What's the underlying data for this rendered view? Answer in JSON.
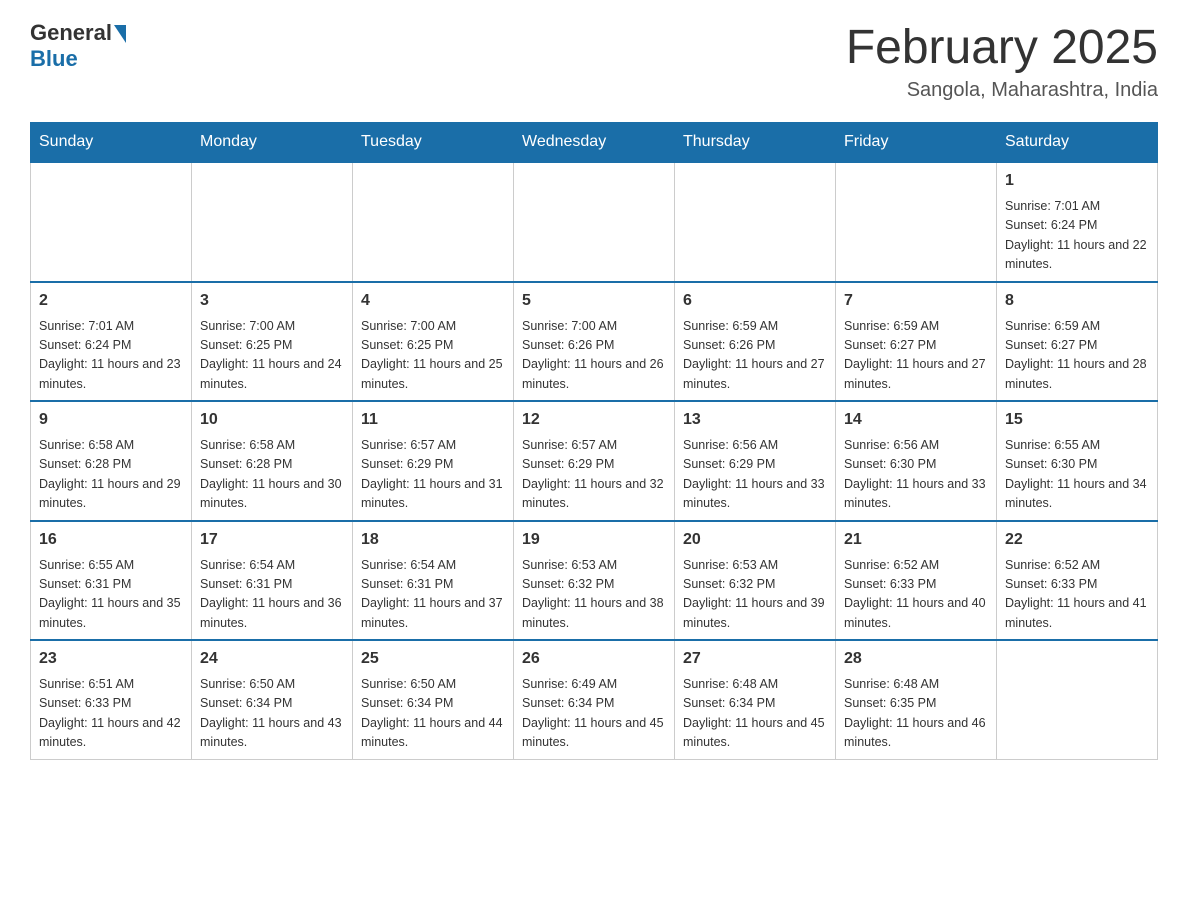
{
  "logo": {
    "general": "General",
    "blue": "Blue"
  },
  "title": "February 2025",
  "location": "Sangola, Maharashtra, India",
  "days_of_week": [
    "Sunday",
    "Monday",
    "Tuesday",
    "Wednesday",
    "Thursday",
    "Friday",
    "Saturday"
  ],
  "weeks": [
    [
      {
        "day": "",
        "sunrise": "",
        "sunset": "",
        "daylight": ""
      },
      {
        "day": "",
        "sunrise": "",
        "sunset": "",
        "daylight": ""
      },
      {
        "day": "",
        "sunrise": "",
        "sunset": "",
        "daylight": ""
      },
      {
        "day": "",
        "sunrise": "",
        "sunset": "",
        "daylight": ""
      },
      {
        "day": "",
        "sunrise": "",
        "sunset": "",
        "daylight": ""
      },
      {
        "day": "",
        "sunrise": "",
        "sunset": "",
        "daylight": ""
      },
      {
        "day": "1",
        "sunrise": "Sunrise: 7:01 AM",
        "sunset": "Sunset: 6:24 PM",
        "daylight": "Daylight: 11 hours and 22 minutes."
      }
    ],
    [
      {
        "day": "2",
        "sunrise": "Sunrise: 7:01 AM",
        "sunset": "Sunset: 6:24 PM",
        "daylight": "Daylight: 11 hours and 23 minutes."
      },
      {
        "day": "3",
        "sunrise": "Sunrise: 7:00 AM",
        "sunset": "Sunset: 6:25 PM",
        "daylight": "Daylight: 11 hours and 24 minutes."
      },
      {
        "day": "4",
        "sunrise": "Sunrise: 7:00 AM",
        "sunset": "Sunset: 6:25 PM",
        "daylight": "Daylight: 11 hours and 25 minutes."
      },
      {
        "day": "5",
        "sunrise": "Sunrise: 7:00 AM",
        "sunset": "Sunset: 6:26 PM",
        "daylight": "Daylight: 11 hours and 26 minutes."
      },
      {
        "day": "6",
        "sunrise": "Sunrise: 6:59 AM",
        "sunset": "Sunset: 6:26 PM",
        "daylight": "Daylight: 11 hours and 27 minutes."
      },
      {
        "day": "7",
        "sunrise": "Sunrise: 6:59 AM",
        "sunset": "Sunset: 6:27 PM",
        "daylight": "Daylight: 11 hours and 27 minutes."
      },
      {
        "day": "8",
        "sunrise": "Sunrise: 6:59 AM",
        "sunset": "Sunset: 6:27 PM",
        "daylight": "Daylight: 11 hours and 28 minutes."
      }
    ],
    [
      {
        "day": "9",
        "sunrise": "Sunrise: 6:58 AM",
        "sunset": "Sunset: 6:28 PM",
        "daylight": "Daylight: 11 hours and 29 minutes."
      },
      {
        "day": "10",
        "sunrise": "Sunrise: 6:58 AM",
        "sunset": "Sunset: 6:28 PM",
        "daylight": "Daylight: 11 hours and 30 minutes."
      },
      {
        "day": "11",
        "sunrise": "Sunrise: 6:57 AM",
        "sunset": "Sunset: 6:29 PM",
        "daylight": "Daylight: 11 hours and 31 minutes."
      },
      {
        "day": "12",
        "sunrise": "Sunrise: 6:57 AM",
        "sunset": "Sunset: 6:29 PM",
        "daylight": "Daylight: 11 hours and 32 minutes."
      },
      {
        "day": "13",
        "sunrise": "Sunrise: 6:56 AM",
        "sunset": "Sunset: 6:29 PM",
        "daylight": "Daylight: 11 hours and 33 minutes."
      },
      {
        "day": "14",
        "sunrise": "Sunrise: 6:56 AM",
        "sunset": "Sunset: 6:30 PM",
        "daylight": "Daylight: 11 hours and 33 minutes."
      },
      {
        "day": "15",
        "sunrise": "Sunrise: 6:55 AM",
        "sunset": "Sunset: 6:30 PM",
        "daylight": "Daylight: 11 hours and 34 minutes."
      }
    ],
    [
      {
        "day": "16",
        "sunrise": "Sunrise: 6:55 AM",
        "sunset": "Sunset: 6:31 PM",
        "daylight": "Daylight: 11 hours and 35 minutes."
      },
      {
        "day": "17",
        "sunrise": "Sunrise: 6:54 AM",
        "sunset": "Sunset: 6:31 PM",
        "daylight": "Daylight: 11 hours and 36 minutes."
      },
      {
        "day": "18",
        "sunrise": "Sunrise: 6:54 AM",
        "sunset": "Sunset: 6:31 PM",
        "daylight": "Daylight: 11 hours and 37 minutes."
      },
      {
        "day": "19",
        "sunrise": "Sunrise: 6:53 AM",
        "sunset": "Sunset: 6:32 PM",
        "daylight": "Daylight: 11 hours and 38 minutes."
      },
      {
        "day": "20",
        "sunrise": "Sunrise: 6:53 AM",
        "sunset": "Sunset: 6:32 PM",
        "daylight": "Daylight: 11 hours and 39 minutes."
      },
      {
        "day": "21",
        "sunrise": "Sunrise: 6:52 AM",
        "sunset": "Sunset: 6:33 PM",
        "daylight": "Daylight: 11 hours and 40 minutes."
      },
      {
        "day": "22",
        "sunrise": "Sunrise: 6:52 AM",
        "sunset": "Sunset: 6:33 PM",
        "daylight": "Daylight: 11 hours and 41 minutes."
      }
    ],
    [
      {
        "day": "23",
        "sunrise": "Sunrise: 6:51 AM",
        "sunset": "Sunset: 6:33 PM",
        "daylight": "Daylight: 11 hours and 42 minutes."
      },
      {
        "day": "24",
        "sunrise": "Sunrise: 6:50 AM",
        "sunset": "Sunset: 6:34 PM",
        "daylight": "Daylight: 11 hours and 43 minutes."
      },
      {
        "day": "25",
        "sunrise": "Sunrise: 6:50 AM",
        "sunset": "Sunset: 6:34 PM",
        "daylight": "Daylight: 11 hours and 44 minutes."
      },
      {
        "day": "26",
        "sunrise": "Sunrise: 6:49 AM",
        "sunset": "Sunset: 6:34 PM",
        "daylight": "Daylight: 11 hours and 45 minutes."
      },
      {
        "day": "27",
        "sunrise": "Sunrise: 6:48 AM",
        "sunset": "Sunset: 6:34 PM",
        "daylight": "Daylight: 11 hours and 45 minutes."
      },
      {
        "day": "28",
        "sunrise": "Sunrise: 6:48 AM",
        "sunset": "Sunset: 6:35 PM",
        "daylight": "Daylight: 11 hours and 46 minutes."
      },
      {
        "day": "",
        "sunrise": "",
        "sunset": "",
        "daylight": ""
      }
    ]
  ]
}
